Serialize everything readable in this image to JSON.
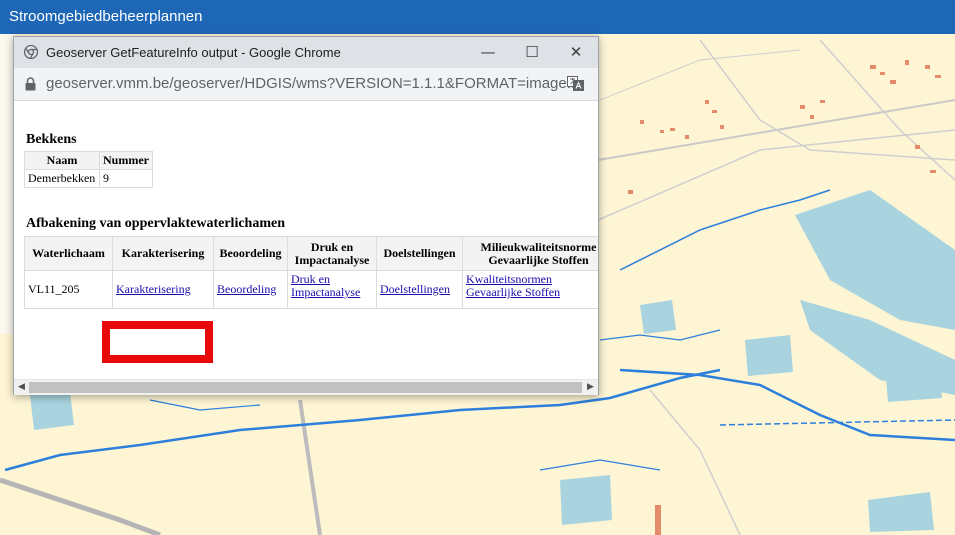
{
  "app": {
    "title": "Stroomgebiedbeheerplannen"
  },
  "popup": {
    "window_title": "Geoserver GetFeatureInfo output - Google Chrome",
    "url": "geoserver.vmm.be/geoserver/HDGIS/wms?VERSION=1.1.1&FORMAT=image...",
    "controls": {
      "minimize": "—",
      "maximize": "☐",
      "close": "✕"
    },
    "scroll_left": "◀",
    "scroll_right": "▶"
  },
  "bekkens": {
    "heading": "Bekkens",
    "headers": [
      "Naam",
      "Nummer"
    ],
    "row": [
      "Demerbekken",
      "9"
    ]
  },
  "afbakening": {
    "heading": "Afbakening van oppervlaktewaterlichamen",
    "headers": {
      "waterlichaam": "Waterlichaam",
      "karakterisering": "Karakterisering",
      "beoordeling": "Beoordeling",
      "druk_line1": "Druk en",
      "druk_line2": "Impactanalyse",
      "doelstellingen": "Doelstellingen",
      "milieu_line1": "Milieukwaliteitsnorme",
      "milieu_line2": "Gevaarlijke Stoffen"
    },
    "row": {
      "waterlichaam": "VL11_205",
      "karakterisering": "Karakterisering",
      "beoordeling": "Beoordeling",
      "druk_line1": "Druk en",
      "druk_line2": "Impactanalyse",
      "doelstellingen": "Doelstellingen",
      "milieu_line1": "Kwaliteitsnormen",
      "milieu_line2": "Gevaarlijke Stoffen"
    }
  },
  "colors": {
    "topbar": "#1e67b7",
    "map_land": "#fdf5d4",
    "water": "#a9d3df",
    "river": "#2d7fdc",
    "highlight": "#e8090a",
    "link": "#1a0dab"
  }
}
